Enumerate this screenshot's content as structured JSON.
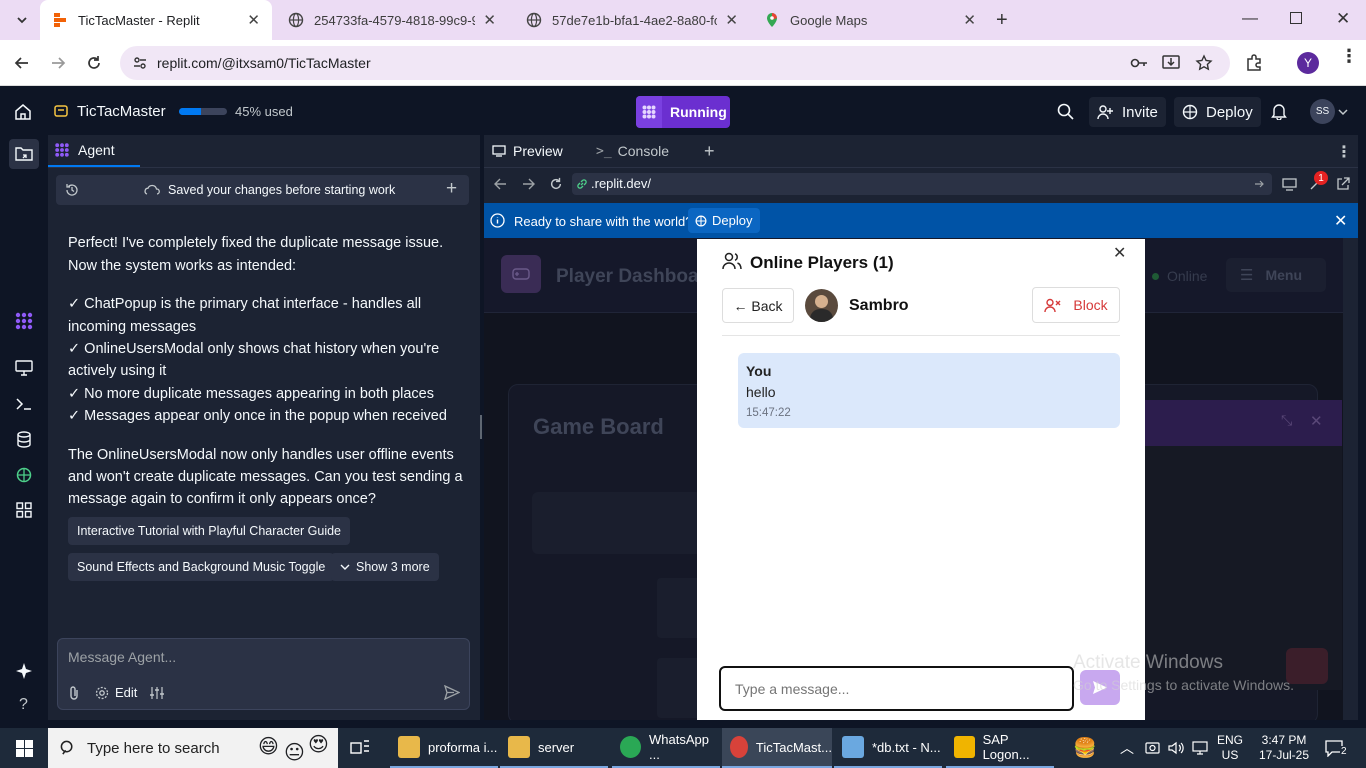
{
  "browser": {
    "tabs": [
      {
        "title": "TicTacMaster - Replit",
        "active": true
      },
      {
        "title": "254733fa-4579-4818-99c9-9fab",
        "active": false
      },
      {
        "title": "57de7e1b-bfa1-4ae2-8a80-fc3c",
        "active": false
      },
      {
        "title": "Google Maps",
        "active": false
      }
    ],
    "url": "replit.com/@itxsam0/TicTacMaster",
    "profile_initial": "Y"
  },
  "replit": {
    "project_name": "TicTacMaster",
    "usage_percent": 45,
    "usage_label": "45% used",
    "run_status": "Running",
    "invite_label": "Invite",
    "deploy_label": "Deploy",
    "avatar_initials": "SS"
  },
  "agent": {
    "tab_label": "Agent",
    "checkpoint_text": "Saved your changes before starting work",
    "para1_line1": "Perfect! I've completely fixed the duplicate message issue.",
    "para1_line2": "Now the system works as intended:",
    "bullets": [
      "✓ ChatPopup is the primary chat interface - handles all",
      "incoming messages",
      "✓ OnlineUsersModal only shows chat history when you're",
      "actively using it",
      "✓ No more duplicate messages appearing in both places",
      "✓ Messages appear only once in the popup when received"
    ],
    "para2": [
      "The OnlineUsersModal now only handles user offline events",
      "and won't create duplicate messages. Can you test sending a",
      "message again to confirm it only appears once?"
    ],
    "suggestions": [
      "Interactive Tutorial with Playful Character Guide",
      "Sound Effects and Background Music Toggle"
    ],
    "show_more": "Show 3 more",
    "input_placeholder": "Message Agent...",
    "edit_label": "Edit"
  },
  "preview": {
    "tab_preview": "Preview",
    "tab_console": "Console",
    "url": ".replit.dev/",
    "devtools_badge": "1",
    "banner_text": "Ready to share with the world?",
    "banner_deploy": "Deploy",
    "app": {
      "dashboard_title": "Player Dashboard",
      "online_label": "Online",
      "menu_label": "Menu",
      "game_board_title": "Game Board"
    }
  },
  "popup": {
    "title": "Online Players (1)",
    "back_label": "← Back",
    "username": "Sambro",
    "block_label": "Block",
    "messages": [
      {
        "sender": "You",
        "text": "hello",
        "time": "15:47:22"
      }
    ],
    "input_placeholder": "Type a message..."
  },
  "watermark": {
    "line1": "Activate Windows",
    "line2": "Go to Settings to activate Windows."
  },
  "taskbar": {
    "search_placeholder": "Type here to search",
    "apps": [
      {
        "label": "proforma i...",
        "color": "#e8b84a"
      },
      {
        "label": "server",
        "color": "#e8b84a"
      },
      {
        "label": "WhatsApp ...",
        "color": "#2aa855"
      },
      {
        "label": "TicTacMast...",
        "color": "#2aa855"
      },
      {
        "label": "*db.txt - N...",
        "color": "#6aa8e0"
      },
      {
        "label": "SAP Logon...",
        "color": "#f0b400"
      }
    ],
    "lang_top": "ENG",
    "lang_bottom": "US",
    "time": "3:47 PM",
    "date": "17-Jul-25",
    "notifications": "2"
  }
}
